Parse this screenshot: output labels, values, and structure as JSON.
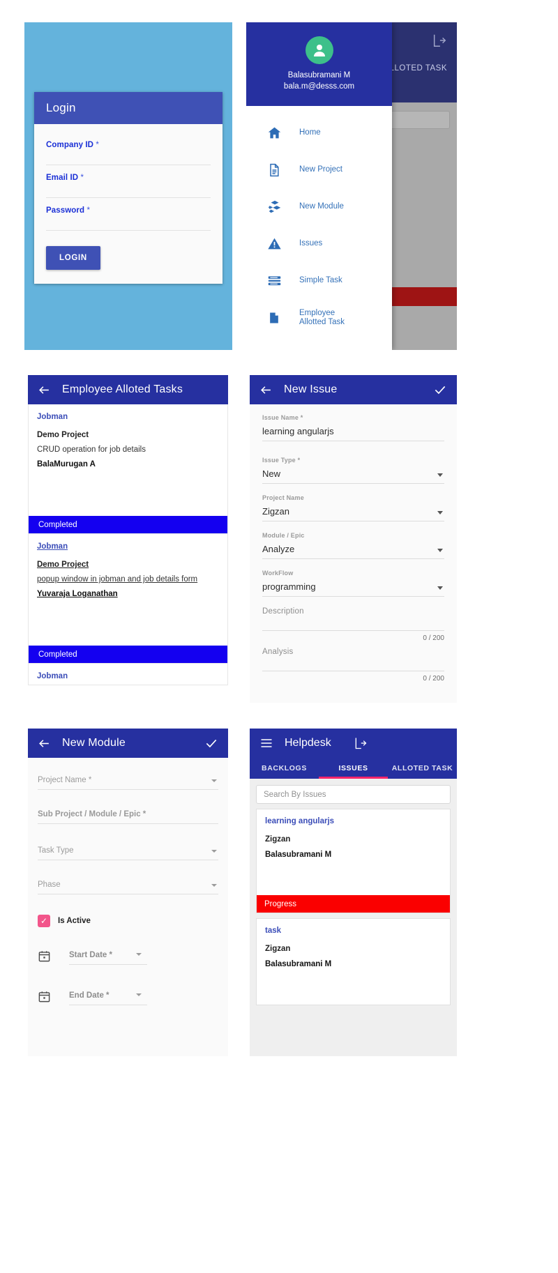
{
  "login": {
    "header": "Login",
    "fields": [
      {
        "label": "Company ID",
        "required": "*",
        "value": "",
        "placeholder": ""
      },
      {
        "label": "Email ID",
        "required": "*",
        "value": "",
        "placeholder": ""
      },
      {
        "label": "Password",
        "required": "*",
        "value": "",
        "placeholder": ""
      }
    ],
    "submit_label": "LOGIN",
    "background_color": "#64b3dc",
    "accent_color": "#3f51b5",
    "label_color": "#1a2fd6"
  },
  "drawer": {
    "user_name": "Balasubramani M",
    "user_email": "bala.m@desss.com",
    "avatar_icon": "user-icon",
    "header_color": "#2630a0",
    "avatar_color": "#3dc08a",
    "items": [
      {
        "label": "Home",
        "icon": "home-icon"
      },
      {
        "label": "New Project",
        "icon": "document-icon"
      },
      {
        "label": "New Module",
        "icon": "blocks-icon"
      },
      {
        "label": "Issues",
        "icon": "warning-triangle-icon"
      },
      {
        "label": "Simple Task",
        "icon": "list-icon"
      },
      {
        "label": "Employee Allotted Task",
        "icon": "file-icon"
      }
    ],
    "behind": {
      "tab_label": "LLOTED TASK",
      "logout_icon": "logout-icon",
      "appbar_color": "#2b3170",
      "scrim_color": "#a9a9a9",
      "status_bar_color": "#9e1414"
    }
  },
  "employee_tasks": {
    "back_icon": "back-arrow-icon",
    "title": "Employee Alloted Tasks",
    "cards": [
      {
        "title": "Jobman",
        "project": "Demo Project",
        "description": "CRUD operation for job details",
        "owner": "BalaMurugan A",
        "status": "Completed",
        "status_color": "#1400f0",
        "underlined": false
      },
      {
        "title": "Jobman",
        "project": "Demo Project",
        "description": "popup window in jobman and job details form",
        "owner": "Yuvaraja Loganathan",
        "status": "Completed",
        "status_color": "#1400f0",
        "underlined": true
      },
      {
        "title": "Jobman",
        "project": "",
        "description": "",
        "owner": "",
        "status": "",
        "status_color": "#1400f0",
        "underlined": false
      }
    ]
  },
  "new_issue": {
    "back_icon": "back-arrow-icon",
    "title": "New Issue",
    "save_icon": "check-icon",
    "fields": [
      {
        "label": "Issue Name",
        "required": "*",
        "value": "learning  angularjs",
        "type": "text"
      },
      {
        "label": "Issue Type",
        "required": "*",
        "value": "New",
        "type": "select"
      },
      {
        "label": "Project Name",
        "required": "",
        "value": "Zigzan",
        "type": "select"
      },
      {
        "label": "Module / Epic",
        "required": "",
        "value": "Analyze",
        "type": "select"
      },
      {
        "label": "WorkFlow",
        "required": "",
        "value": "programming",
        "type": "select"
      }
    ],
    "textareas": [
      {
        "label": "Description",
        "value": "",
        "counter": "0 / 200"
      },
      {
        "label": "Analysis",
        "value": "",
        "counter": "0 / 200"
      }
    ]
  },
  "new_module": {
    "back_icon": "back-arrow-icon",
    "title": "New Module",
    "save_icon": "check-icon",
    "fields": [
      {
        "label": "Project Name *",
        "bold": false,
        "caret": true
      },
      {
        "label": "Sub Project / Module / Epic *",
        "bold": true,
        "caret": false
      },
      {
        "label": "Task Type",
        "bold": false,
        "caret": true
      },
      {
        "label": "Phase",
        "bold": false,
        "caret": true
      }
    ],
    "checkbox": {
      "label": "Is Active",
      "checked": true,
      "color": "#f2558a",
      "icon": "checkmark-icon"
    },
    "dates": [
      {
        "placeholder": "Start Date *",
        "icon": "calendar-icon"
      },
      {
        "placeholder": "End Date *",
        "icon": "calendar-icon"
      }
    ]
  },
  "helpdesk": {
    "menu_icon": "hamburger-menu-icon",
    "title": "Helpdesk",
    "logout_icon": "logout-icon",
    "tabs": [
      {
        "label": "BACKLOGS",
        "active": false
      },
      {
        "label": "ISSUES",
        "active": true
      },
      {
        "label": "ALLOTED TASK",
        "active": false
      }
    ],
    "tab_indicator_color": "#f5256b",
    "search": {
      "placeholder": "Search By Issues",
      "value": "",
      "icon": "search-icon"
    },
    "cards": [
      {
        "title": "learning angularjs",
        "project": "Zigzan",
        "owner": "Balasubramani M",
        "status": "Progress",
        "status_color": "#fa0000"
      },
      {
        "title": "task",
        "project": "Zigzan",
        "owner": "Balasubramani M",
        "status": "",
        "status_color": "#fa0000"
      }
    ]
  }
}
